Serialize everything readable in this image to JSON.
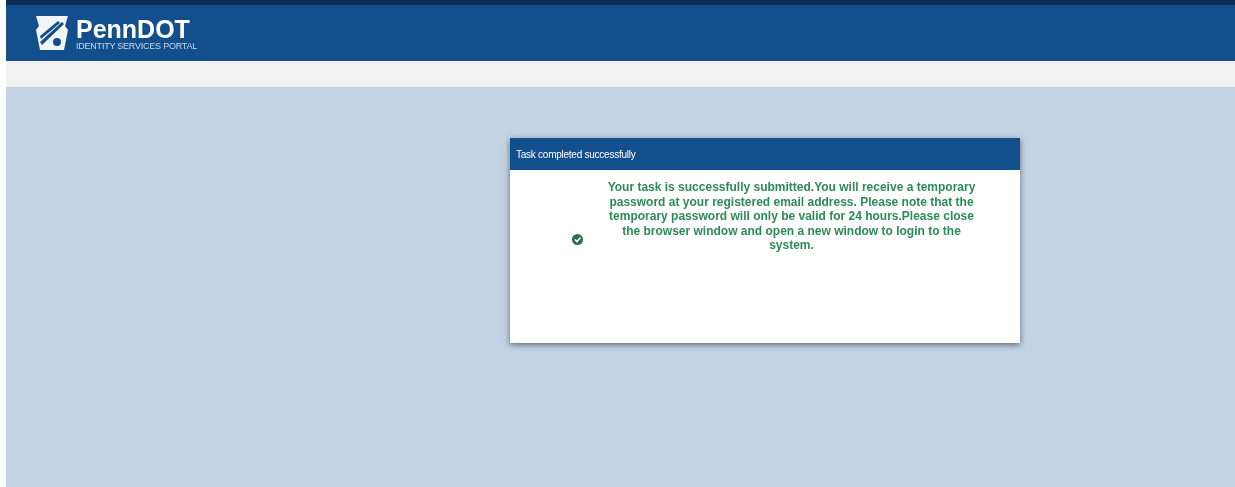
{
  "header": {
    "brand": "PennDOT",
    "subtitle": "IDENTITY SERVICES PORTAL"
  },
  "dialog": {
    "title": "Task completed successfully",
    "message": "Your task is successfully submitted.You will receive a temporary password at your registered email address. Please note that the temporary password will only be valid for 24 hours.Please close the browser window and open a new window to login to the system."
  }
}
